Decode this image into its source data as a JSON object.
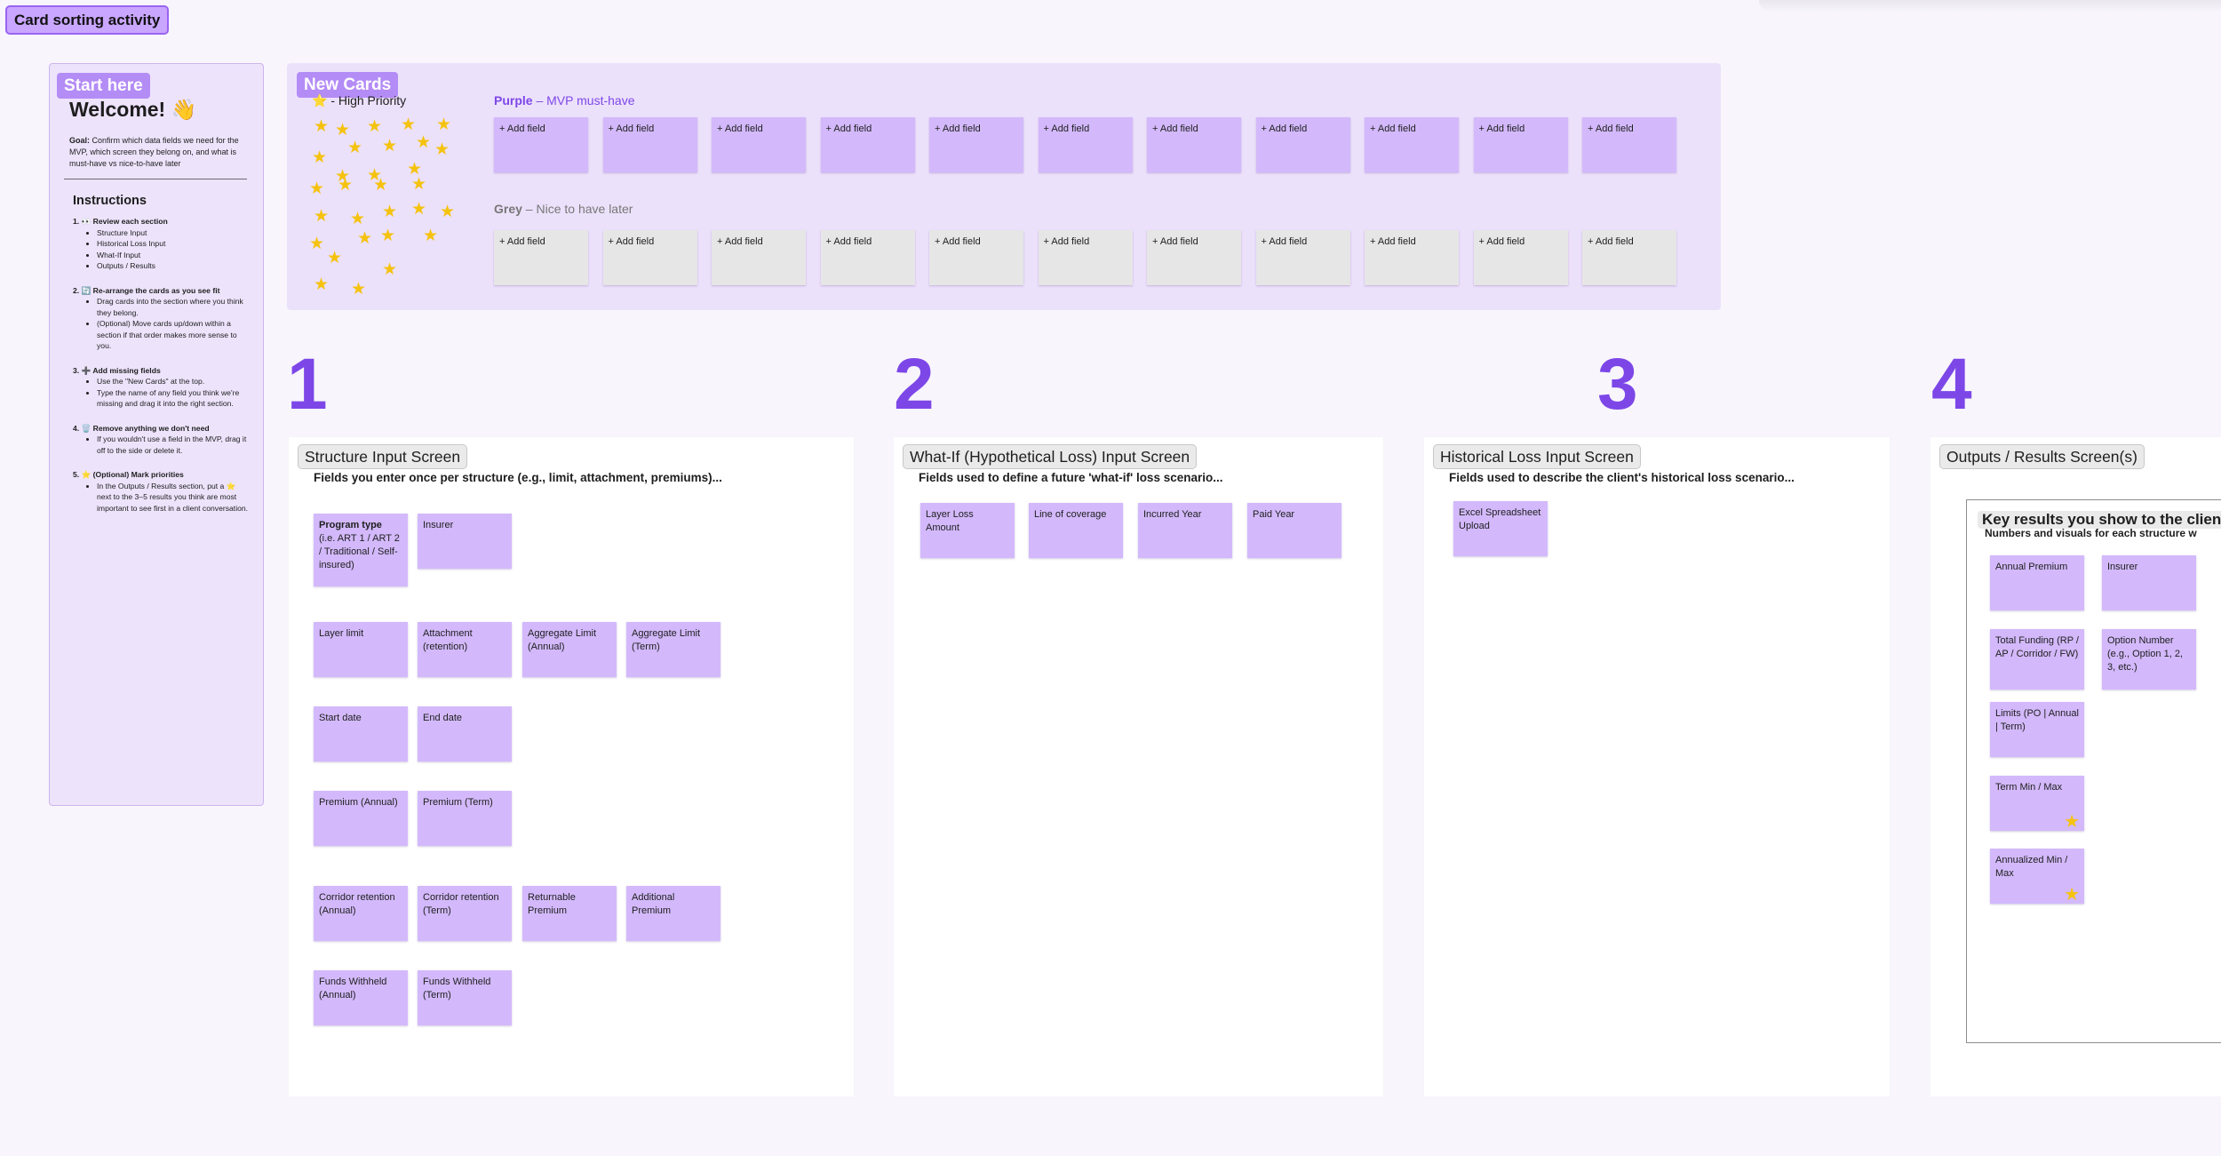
{
  "board": {
    "title": "Card sorting activity"
  },
  "intro": {
    "tag": "Start here",
    "welcome": "Welcome! 👋",
    "goal_label": "Goal:",
    "goal_text": " Confirm which data fields we need for the MVP, which screen they belong on, and what is must-have vs nice-to-have later",
    "instructions_title": "Instructions",
    "steps": [
      {
        "title": "1. 👀 Review each section",
        "items": [
          "Structure Input",
          "Historical Loss Input",
          "What-If Input",
          "Outputs / Results"
        ]
      },
      {
        "title": "2. 🔄 Re-arrange the cards as you see fit",
        "items": [
          "Drag cards into the section where you think they belong.",
          "(Optional) Move cards up/down within a section if that order makes more sense to you."
        ]
      },
      {
        "title": "3. ➕ Add missing fields",
        "items": [
          "Use the \"New Cards\" at the top.",
          "Type the name of any field you think we're missing and drag it into the right section."
        ]
      },
      {
        "title": "4. 🗑️ Remove anything we don't need",
        "items": [
          "If you wouldn't use a field in the MVP, drag it off to the side or delete it."
        ]
      },
      {
        "title": "5. ⭐ (Optional) Mark priorities",
        "items": [
          "In the Outputs / Results section, put a ⭐ next to the 3–5 results you think are most important to see first in a client conversation."
        ]
      }
    ]
  },
  "new_cards": {
    "tag": "New Cards",
    "high_priority": "⭐ - High Priority",
    "purple_label": "Purple",
    "purple_desc": " – MVP must-have",
    "grey_label": "Grey",
    "grey_desc": " – Nice to have later",
    "add_field": "+ Add field",
    "purple_count": 11,
    "grey_count": 11
  },
  "sections": [
    {
      "number": "1",
      "title": "Structure Input Screen",
      "description": "Fields you enter once per structure (e.g., limit, attachment, premiums)...",
      "cards": [
        {
          "label": "Program type",
          "sub": "(i.e. ART 1 / ART 2 / Traditional / Self-insured)"
        },
        {
          "label": "Insurer"
        },
        {
          "label": "Layer limit"
        },
        {
          "label": "Attachment (retention)"
        },
        {
          "label": "Aggregate Limit (Annual)"
        },
        {
          "label": "Aggregate Limit (Term)"
        },
        {
          "label": "Start date"
        },
        {
          "label": "End date"
        },
        {
          "label": "Premium (Annual)"
        },
        {
          "label": "Premium (Term)"
        },
        {
          "label": "Corridor retention (Annual)"
        },
        {
          "label": "Corridor retention (Term)"
        },
        {
          "label": "Returnable Premium"
        },
        {
          "label": "Additional Premium"
        },
        {
          "label": "Funds Withheld (Annual)"
        },
        {
          "label": "Funds Withheld (Term)"
        }
      ]
    },
    {
      "number": "2",
      "title": "What-If (Hypothetical Loss) Input Screen",
      "description": "Fields used to define a future 'what-if' loss scenario...",
      "cards": [
        {
          "label": "Layer Loss Amount"
        },
        {
          "label": "Line of coverage"
        },
        {
          "label": "Incurred Year"
        },
        {
          "label": "Paid Year"
        }
      ]
    },
    {
      "number": "3",
      "title": "Historical Loss Input Screen",
      "description": "Fields used to describe the client's historical loss scenario...",
      "cards": [
        {
          "label": "Excel Spreadsheet Upload"
        }
      ]
    },
    {
      "number": "4",
      "title": "Outputs / Results Screen(s)",
      "frame_title": "Key results you show to the client",
      "frame_sub": "Numbers and visuals for each structure w",
      "cards": [
        {
          "label": "Annual Premium"
        },
        {
          "label": "Insurer"
        },
        {
          "label": "Total Funding (RP / AP / Corridor / FW)"
        },
        {
          "label": "Option Number (e.g., Option 1, 2, 3, etc.)"
        },
        {
          "label": "Limits (PO | Annual | Term)"
        },
        {
          "label": "Term Min / Max",
          "starred": true
        },
        {
          "label": "Annualized Min / Max",
          "starred": true
        }
      ]
    }
  ],
  "colors": {
    "accent": "#7d47e8",
    "card_purple": "#d3b9fb",
    "card_grey": "#e6e6e6",
    "star": "#f5c20f"
  }
}
